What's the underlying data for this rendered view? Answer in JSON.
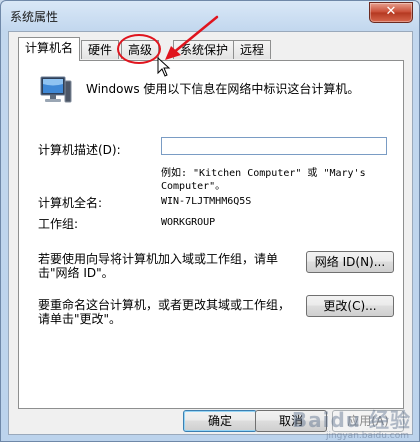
{
  "window": {
    "title": "系统属性",
    "close_glyph": "✕"
  },
  "tabs": [
    {
      "label": "计算机名",
      "active": true
    },
    {
      "label": "硬件",
      "active": false
    },
    {
      "label": "高级",
      "active": false
    },
    {
      "label": "系统保护",
      "active": false
    },
    {
      "label": "远程",
      "active": false
    }
  ],
  "panel": {
    "intro": "Windows 使用以下信息在网络中标识这台计算机。",
    "description_label": "计算机描述(D):",
    "description_value": "",
    "example_line1": "例如: \"Kitchen Computer\" 或 \"Mary's",
    "example_line2": "Computer\"。",
    "fullname_label": "计算机全名:",
    "fullname_value": "WIN-7LJTMHM6Q5S",
    "workgroup_label": "工作组:",
    "workgroup_value": "WORKGROUP",
    "network_text_line1": "若要使用向导将计算机加入域或工作组，请单",
    "network_text_line2": "击\"网络 ID\"。",
    "network_button": "网络 ID(N)...",
    "rename_text_line1": "要重命名这台计算机，或者更改其域或工作组，",
    "rename_text_line2": "请单击\"更改\"。",
    "change_button": "更改(C)..."
  },
  "footer": {
    "ok": "确定",
    "cancel": "取消",
    "apply": "应用(A)"
  },
  "watermark": {
    "text": "Baidu 经验",
    "sub": "jingyan.baidu.com"
  },
  "colors": {
    "annotation": "#e0141e",
    "title_bar": "#c2d7ee",
    "close_button": "#c84a33"
  },
  "icons": [
    "computer-icon",
    "close-icon",
    "cursor-icon",
    "arrow-annotation"
  ]
}
